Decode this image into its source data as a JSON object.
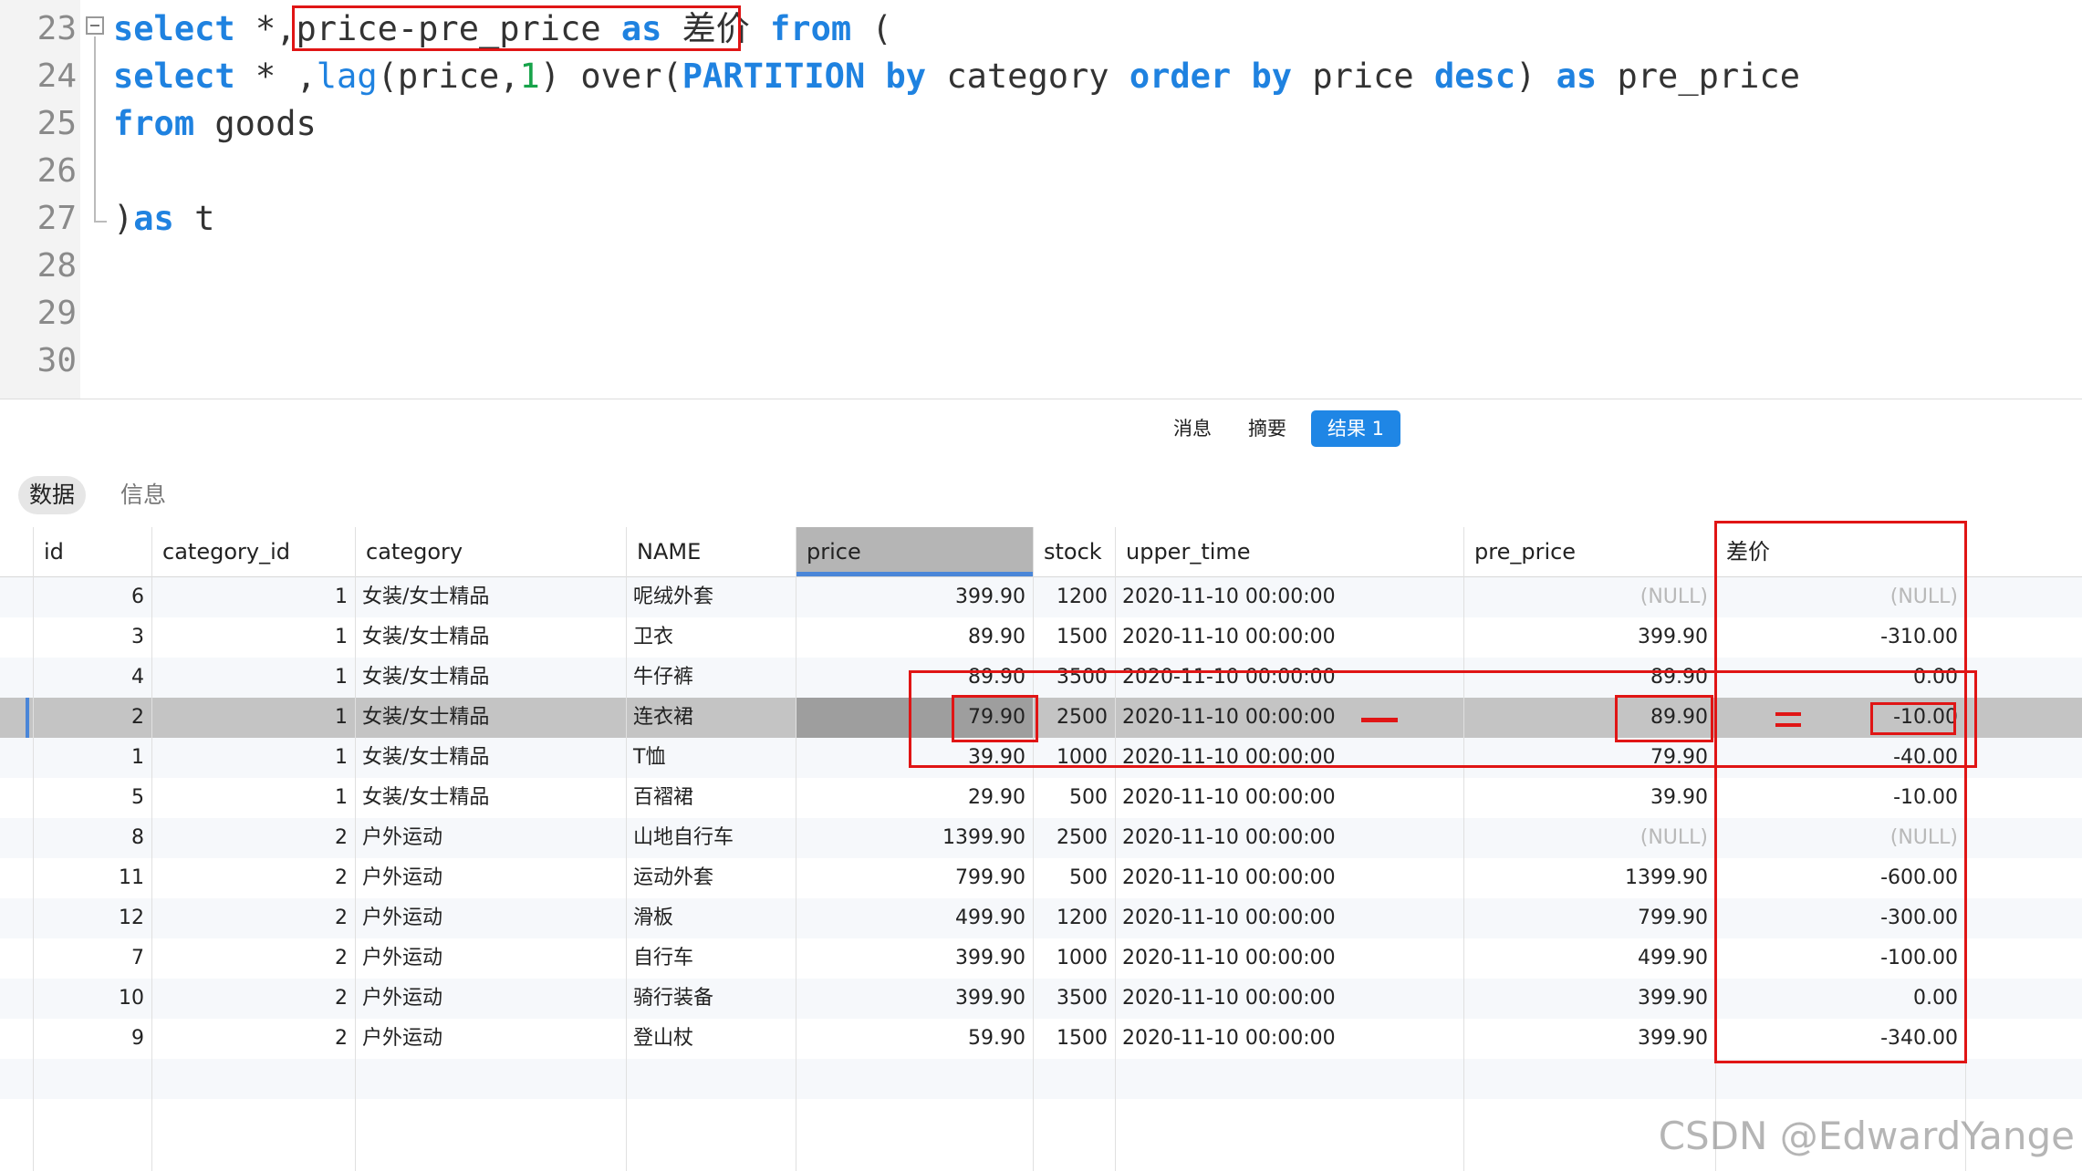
{
  "editor": {
    "lines": [
      {
        "no": "23",
        "tokens": [
          [
            "kw",
            "select"
          ],
          [
            "t",
            " *,"
          ],
          [
            "t",
            "price-pre_price "
          ],
          [
            "kw",
            "as"
          ],
          [
            "t",
            " 差价 "
          ],
          [
            "kw",
            "from"
          ],
          [
            "t",
            " ("
          ]
        ]
      },
      {
        "no": "24",
        "tokens": [
          [
            "kw",
            "select"
          ],
          [
            "t",
            " * ,"
          ],
          [
            "fn",
            "lag"
          ],
          [
            "t",
            "(price,"
          ],
          [
            "num",
            "1"
          ],
          [
            "t",
            ") over("
          ],
          [
            "kw",
            "PARTITION by"
          ],
          [
            "t",
            " category "
          ],
          [
            "kw",
            "order by"
          ],
          [
            "t",
            " price "
          ],
          [
            "kw",
            "desc"
          ],
          [
            "t",
            ") "
          ],
          [
            "kw",
            "as"
          ],
          [
            "t",
            " pre_price"
          ]
        ]
      },
      {
        "no": "25",
        "tokens": [
          [
            "kw",
            "from"
          ],
          [
            "t",
            " goods"
          ]
        ]
      },
      {
        "no": "26",
        "tokens": []
      },
      {
        "no": "27",
        "tokens": [
          [
            "t",
            ")"
          ],
          [
            "kw",
            "as"
          ],
          [
            "t",
            " t"
          ]
        ]
      },
      {
        "no": "28",
        "tokens": []
      },
      {
        "no": "29",
        "tokens": []
      },
      {
        "no": "30",
        "tokens": []
      }
    ]
  },
  "result_tabs": {
    "message": "消息",
    "summary": "摘要",
    "result": "结果 1"
  },
  "sub_tabs": {
    "data": "数据",
    "info": "信息"
  },
  "table": {
    "columns": [
      "id",
      "category_id",
      "category",
      "NAME",
      "price",
      "stock",
      "upper_time",
      "pre_price",
      "差价"
    ],
    "rows": [
      [
        "6",
        "1",
        "女装/女士精品",
        "呢绒外套",
        "399.90",
        "1200",
        "2020-11-10 00:00:00",
        "(NULL)",
        "(NULL)"
      ],
      [
        "3",
        "1",
        "女装/女士精品",
        "卫衣",
        "89.90",
        "1500",
        "2020-11-10 00:00:00",
        "399.90",
        "-310.00"
      ],
      [
        "4",
        "1",
        "女装/女士精品",
        "牛仔裤",
        "89.90",
        "3500",
        "2020-11-10 00:00:00",
        "89.90",
        "0.00"
      ],
      [
        "2",
        "1",
        "女装/女士精品",
        "连衣裙",
        "79.90",
        "2500",
        "2020-11-10 00:00:00",
        "89.90",
        "-10.00"
      ],
      [
        "1",
        "1",
        "女装/女士精品",
        "T恤",
        "39.90",
        "1000",
        "2020-11-10 00:00:00",
        "79.90",
        "-40.00"
      ],
      [
        "5",
        "1",
        "女装/女士精品",
        "百褶裙",
        "29.90",
        "500",
        "2020-11-10 00:00:00",
        "39.90",
        "-10.00"
      ],
      [
        "8",
        "2",
        "户外运动",
        "山地自行车",
        "1399.90",
        "2500",
        "2020-11-10 00:00:00",
        "(NULL)",
        "(NULL)"
      ],
      [
        "11",
        "2",
        "户外运动",
        "运动外套",
        "799.90",
        "500",
        "2020-11-10 00:00:00",
        "1399.90",
        "-600.00"
      ],
      [
        "12",
        "2",
        "户外运动",
        "滑板",
        "499.90",
        "1200",
        "2020-11-10 00:00:00",
        "799.90",
        "-300.00"
      ],
      [
        "7",
        "2",
        "户外运动",
        "自行车",
        "399.90",
        "1000",
        "2020-11-10 00:00:00",
        "499.90",
        "-100.00"
      ],
      [
        "10",
        "2",
        "户外运动",
        "骑行装备",
        "399.90",
        "3500",
        "2020-11-10 00:00:00",
        "399.90",
        "0.00"
      ],
      [
        "9",
        "2",
        "户外运动",
        "登山杖",
        "59.90",
        "1500",
        "2020-11-10 00:00:00",
        "399.90",
        "-340.00"
      ]
    ],
    "selected_row_index": 3,
    "selected_column": "price"
  },
  "colors": {
    "keyword": "#1f82e0",
    "number": "#17a34a",
    "annotation": "#e01515",
    "active_tab": "#1f86e5"
  },
  "watermark": "CSDN @EdwardYange"
}
